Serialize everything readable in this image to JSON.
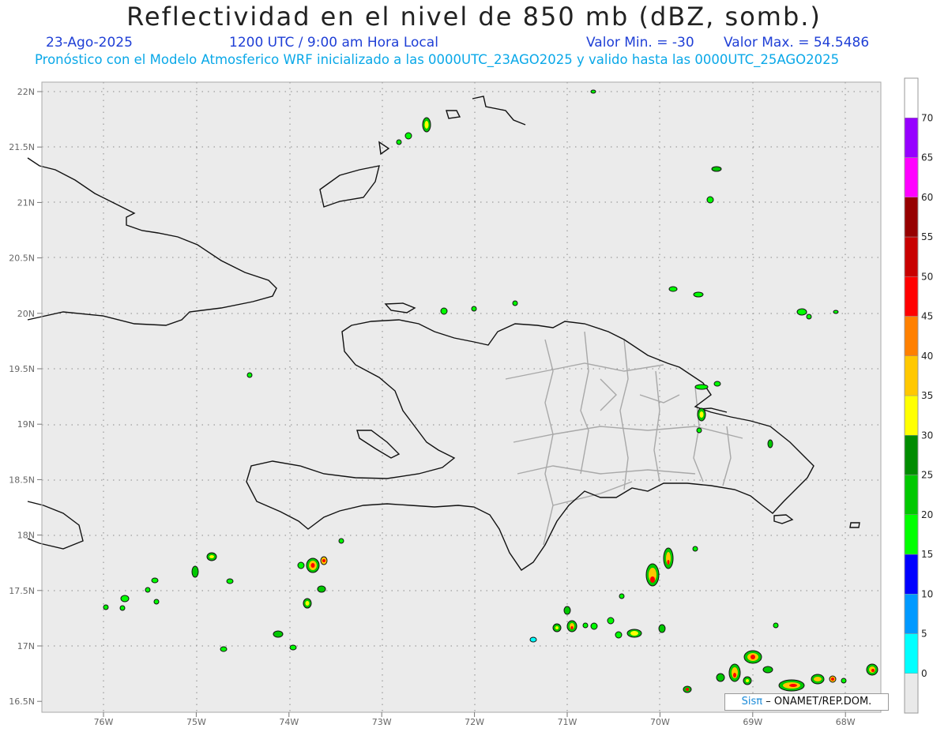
{
  "header": {
    "title": "Reflectividad en el nivel de 850 mb (dBZ, somb.)",
    "date": "23-Ago-2025",
    "time": "1200 UTC / 9:00 am Hora Local",
    "min": "Valor Min. = -30",
    "max": "Valor Max. = 54.5486",
    "subtitle": "Pronóstico con el Modelo Atmosferico WRF inicializado a las 0000UTC_23AGO2025 y valido hasta las  0000UTC_25AGO2025"
  },
  "axes": {
    "y_labels": [
      "22N",
      "21.5N",
      "21N",
      "20.5N",
      "20N",
      "19.5N",
      "19N",
      "18.5N",
      "18N",
      "17.5N",
      "17N",
      "16.5N"
    ],
    "x_labels": [
      "76W",
      "75W",
      "74W",
      "73W",
      "72W",
      "71W",
      "70W",
      "69W",
      "68W"
    ]
  },
  "colorbar": {
    "labels": [
      "0",
      "5",
      "10",
      "15",
      "20",
      "25",
      "30",
      "35",
      "40",
      "45",
      "50",
      "55",
      "60",
      "65",
      "70"
    ],
    "colors": [
      "#e9e9e9",
      "#00ffff",
      "#0099ff",
      "#0000ff",
      "#00ff00",
      "#00c800",
      "#008c00",
      "#ffff00",
      "#ffc800",
      "#ff8000",
      "#ff0000",
      "#c80000",
      "#960000",
      "#ff00ff",
      "#9600ff",
      "#ffffff"
    ]
  },
  "credit": {
    "brand": "Sisπ",
    "org": "– ONAMET/REP.DOM."
  }
}
